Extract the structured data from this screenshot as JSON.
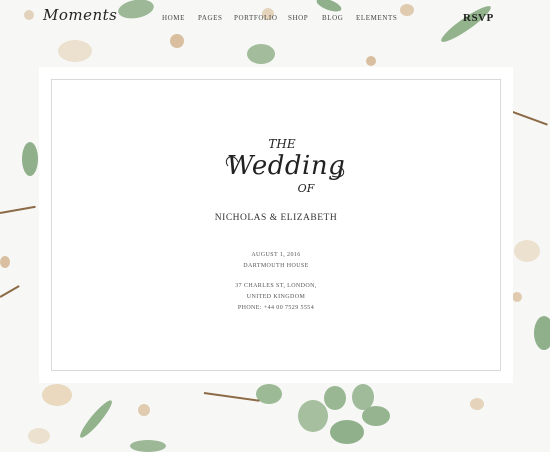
{
  "header": {
    "logo": "Moments",
    "nav": [
      "HOME",
      "PAGES",
      "PORTFOLIO",
      "SHOP",
      "BLOG",
      "ELEMENTS"
    ],
    "rsvp": "RSVP"
  },
  "invitation": {
    "emblem_lines": [
      "THE",
      "Wedding",
      "OF"
    ],
    "couple": "NICHOLAS & ELIZABETH",
    "date": "AUGUST 1, 2016",
    "venue": "DARTMOUTH HOUSE",
    "address_line1": "37 CHARLES ST, LONDON,",
    "address_line2": "UNITED KINGDOM",
    "phone": "PHONE: +44 00 7529 5554"
  },
  "colors": {
    "leaf": "#8fb08a",
    "stem": "#8c6a46",
    "flower": "#e9d9c4",
    "card": "#ffffff"
  }
}
